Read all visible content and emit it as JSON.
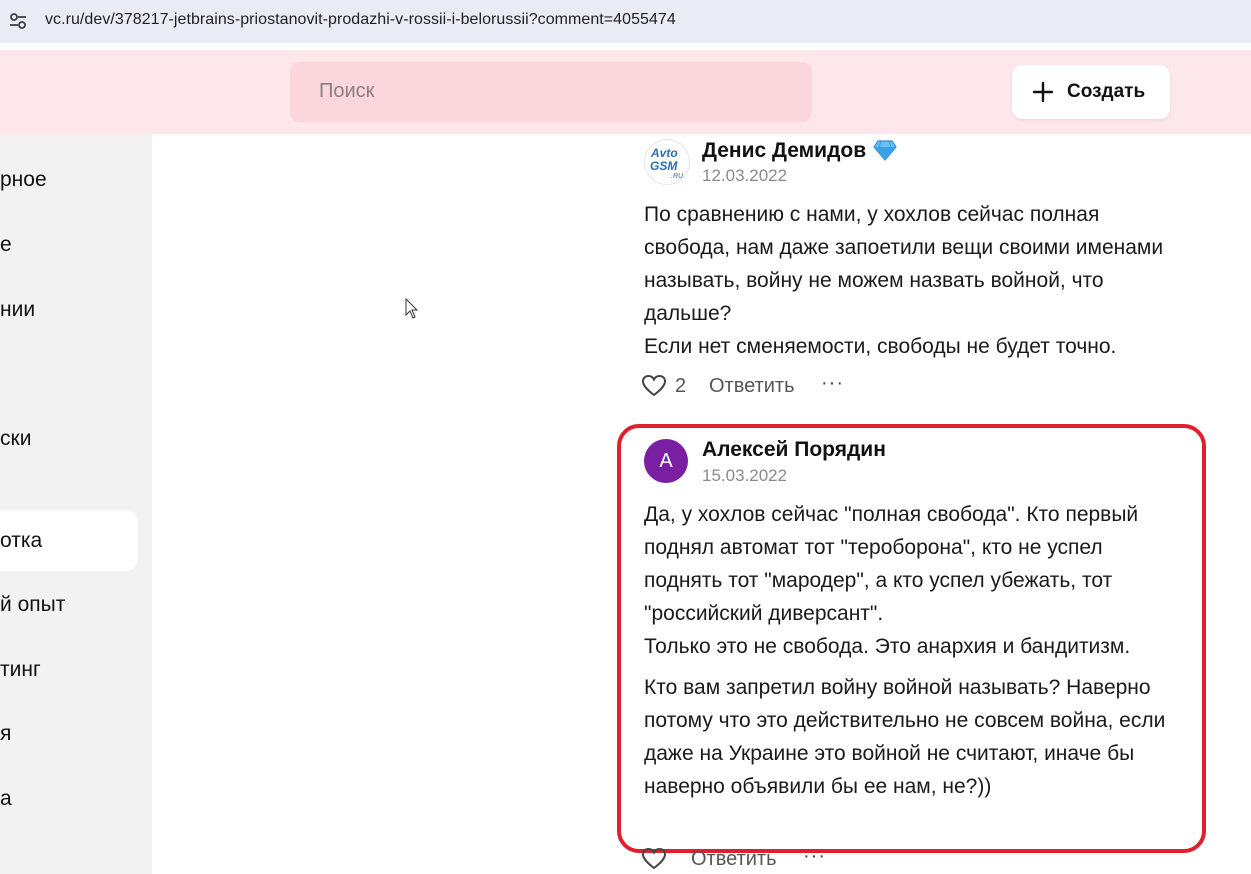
{
  "browser": {
    "url": "vc.ru/dev/378217-jetbrains-priostanovit-prodazhi-v-rossii-i-belorussii?comment=4055474",
    "site_info_icon": "tune-icon"
  },
  "header": {
    "search_placeholder": "Поиск",
    "create_label": "Создать",
    "create_icon": "plus-icon"
  },
  "sidebar": {
    "items": [
      {
        "label": "рное"
      },
      {
        "label": "е"
      },
      {
        "label": "нии"
      },
      {
        "label": "ски"
      },
      {
        "label": "отка",
        "active": true
      },
      {
        "label": "й опыт"
      },
      {
        "label": "тинг"
      },
      {
        "label": "я"
      },
      {
        "label": "а"
      }
    ]
  },
  "comments": [
    {
      "author": "Денис Демидов",
      "badge_icon": "diamond-icon",
      "avatar_text": "AvtoGSM.RU",
      "date": "12.03.2022",
      "paragraphs": [
        "По сравнению с нами, у хохлов сейчас полная свобода, нам даже запоетили вещи своими именами называть, войну не можем назвать войной, что дальше?",
        "Если нет сменяемости, свободы не будет точно."
      ],
      "likes": "2",
      "reply_label": "Ответить",
      "more_label": "···"
    },
    {
      "author": "Алексей Порядин",
      "avatar_letter": "А",
      "date": "15.03.2022",
      "paragraphs": [
        "Да, у хохлов сейчас \"полная свобода\". Кто первый поднял автомат тот \"тероборона\", кто не успел поднять тот \"мародер\", а кто успел убежать, тот \"российский диверсант\".",
        "Только это не свобода. Это анархия и бандитизм.",
        "Кто вам запретил войну войной называть? Наверно потому что это действительно не совсем война, если даже на Украине это войной не считают, иначе бы наверно объявили бы ее нам, не?))"
      ],
      "reply_label": "Ответить",
      "more_label": "···"
    }
  ],
  "colors": {
    "header_bg": "#fde7ea",
    "search_bg": "#fbd6dc",
    "avatar_purple": "#7a1fa2",
    "highlight_red": "#e0202e"
  }
}
